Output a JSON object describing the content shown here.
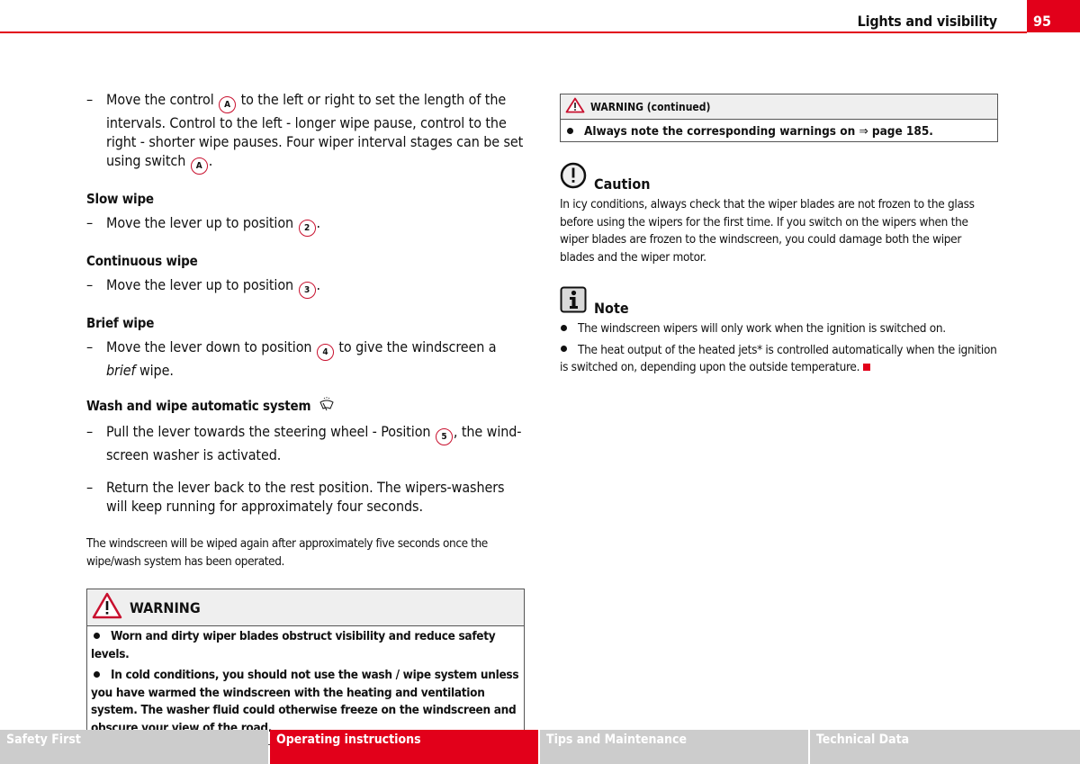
{
  "header": {
    "section_title": "Lights and visibility",
    "page_number": "95",
    "accent_color": "#e2001a"
  },
  "left": {
    "intro_step": {
      "part1": "Move the control ",
      "marker1": "A",
      "part2": " to the left or right to set the length of the intervals. Control to the left - longer wipe pause, control to the right - shorter wipe pauses. Four wiper interval stages can be set using switch ",
      "marker2": "A",
      "part3": "."
    },
    "slow_wipe": {
      "heading": "Slow wipe",
      "text": "Move the lever up to position ",
      "marker": "2",
      "end": "."
    },
    "continuous_wipe": {
      "heading": "Continuous wipe",
      "text": "Move the lever up to position ",
      "marker": "3",
      "end": "."
    },
    "brief_wipe": {
      "heading": "Brief wipe",
      "text": "Move the lever down to position ",
      "marker": "4",
      "text2": " to give the windscreen a ",
      "emph": "brief",
      "end": " wipe."
    },
    "wash_wipe": {
      "heading": "Wash and wipe automatic system",
      "icon": "windscreen-washer-icon",
      "step1_text": "Pull the lever towards the steering wheel - Position ",
      "step1_marker": "5",
      "step1_end": ", the wind-screen washer is activated.",
      "step2": "Return the lever back to the rest position. The wipers-washers will keep running for approximately four seconds."
    },
    "note_paragraph": "The windscreen will be wiped again after approximately five seconds once the wipe/wash system has been operated.",
    "warning": {
      "title": "WARNING",
      "items": [
        "Worn and dirty wiper blades obstruct visibility and reduce safety levels.",
        "In cold conditions, you should not use the wash / wipe system unless you have warmed the windscreen with the heating and ventilation system. The washer fluid could otherwise freeze on the windscreen and obscure your view of the road."
      ]
    }
  },
  "right": {
    "warning_continued": {
      "title": "WARNING (continued)",
      "item_text": "Always note the corresponding warnings on ",
      "arrow": "⇒",
      "item_link": " page 185."
    },
    "caution": {
      "title": "Caution",
      "text": "In icy conditions, always check that the wiper blades are not frozen to the glass before using the wipers for the first time. If you switch on the wipers when the wiper blades are frozen to the windscreen, you could damage both the wiper blades and the wiper motor."
    },
    "note": {
      "title": "Note",
      "items": [
        "The windscreen wipers will only work when the ignition is switched on.",
        "The heat output of the heated jets* is controlled automatically when the ignition is switched on, depending upon the outside temperature."
      ]
    }
  },
  "footer": {
    "tabs": [
      {
        "label": "Safety First",
        "active": false
      },
      {
        "label": "Operating instructions",
        "active": true
      },
      {
        "label": "Tips and Maintenance",
        "active": false
      },
      {
        "label": "Technical Data",
        "active": false
      }
    ]
  }
}
